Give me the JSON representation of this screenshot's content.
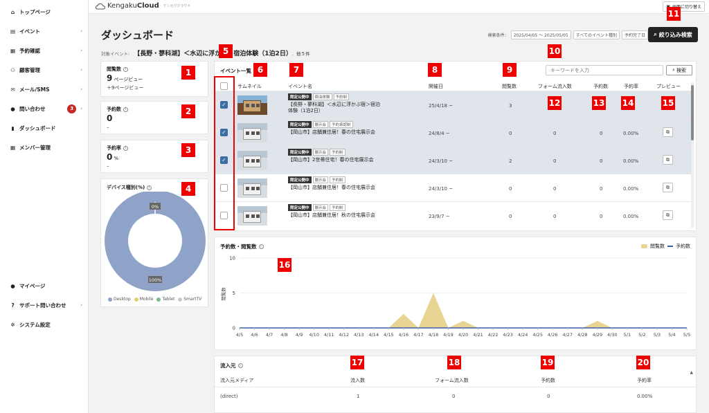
{
  "sidebar": {
    "items": [
      {
        "label": "トップページ",
        "icon": "home-icon",
        "chevron": false
      },
      {
        "label": "イベント",
        "icon": "document-icon",
        "chevron": true
      },
      {
        "label": "予約確認",
        "icon": "calendar-icon",
        "chevron": true
      },
      {
        "label": "顧客管理",
        "icon": "users-icon",
        "chevron": true
      },
      {
        "label": "メール/SMS",
        "icon": "mail-icon",
        "chevron": true
      },
      {
        "label": "問い合わせ",
        "icon": "chat-icon",
        "chevron": true,
        "badge": "3"
      },
      {
        "label": "ダッシュボード",
        "icon": "chart-icon",
        "chevron": false
      },
      {
        "label": "メンバー管理",
        "icon": "grid-icon",
        "chevron": false
      }
    ],
    "bottom_items": [
      {
        "label": "マイページ",
        "icon": "person-icon",
        "chevron": false
      },
      {
        "label": "サポート問い合わせ",
        "icon": "help-icon",
        "chevron": true
      },
      {
        "label": "システム設定",
        "icon": "gear-icon",
        "chevron": false
      }
    ]
  },
  "topbar": {
    "logo_light": "Kengaku",
    "logo_bold": "Cloud",
    "logo_sub": "ケンガククラウド",
    "switch_label": "画面に切り替え"
  },
  "page": {
    "title": "ダッシュボード",
    "target_label": "対象イベント:",
    "target_event": "【長野・蓼科湖】＜水辺に浮か",
    "target_event_rest": "宿泊体験（1泊2日）",
    "target_count": "他５件"
  },
  "filter": {
    "label": "検索条件：",
    "chips": [
      "2025/04/05 〜 2025/05/05",
      "すべてのイベント種別",
      "予約完了日"
    ],
    "search_button": "絞り込み検索"
  },
  "stats": {
    "views": {
      "label": "閲覧数",
      "value": "9",
      "unit": "ページビュー",
      "delta": "＋9ページビュー"
    },
    "reservations": {
      "label": "予約数",
      "value": "0",
      "delta": "–"
    },
    "rate": {
      "label": "予約率",
      "value": "0",
      "unit": "%",
      "delta": "–"
    }
  },
  "device": {
    "title": "デバイス種別(%)",
    "legend": [
      "Desktop",
      "Mobile",
      "Tablet",
      "SmartTV"
    ],
    "colors": [
      "#8fa3c9",
      "#e5cf6b",
      "#7fb68a",
      "#c9c9c9"
    ],
    "values": [
      100,
      0,
      0,
      0
    ],
    "label_top": "0%",
    "label_bottom": "100%"
  },
  "events": {
    "title": "イベント一覧",
    "keyword_placeholder": "キーワードを入力",
    "search_label": "検索",
    "headers": {
      "thumb": "サムネイル",
      "name": "イベント名",
      "date": "開催日",
      "views": "閲覧数",
      "form": "フォーム流入数",
      "reservations": "予約数",
      "rate": "予約率",
      "preview": "プレビュー"
    },
    "rows": [
      {
        "checked": true,
        "tags": [
          "限定公開中",
          "宿泊体験",
          "予約制"
        ],
        "name": "【長野・蓼科湖】＜水辺に浮かぶ宿＞宿泊体験（1泊2日）",
        "date": "25/4/18 ~",
        "views": "3",
        "form": "",
        "reservations": "",
        "rate": "",
        "thumb": "rust"
      },
      {
        "checked": true,
        "tags": [
          "限定公開中",
          "展示会",
          "予約承認制"
        ],
        "name": "【岡山市】店舗兼住居！春の住宅展示会",
        "date": "24/8/4 ~",
        "views": "0",
        "form": "0",
        "reservations": "0",
        "rate": "0.00%",
        "thumb": "white"
      },
      {
        "checked": true,
        "tags": [
          "限定公開中",
          "展示会",
          "予約制"
        ],
        "name": "【岡山市】2世帯住宅！春の住宅展示会",
        "date": "24/3/10 ~",
        "views": "2",
        "form": "0",
        "reservations": "0",
        "rate": "0.00%",
        "thumb": "white"
      },
      {
        "checked": false,
        "tags": [
          "限定公開中",
          "展示会",
          "予約制"
        ],
        "name": "【岡山市】店舗兼住居！春の住宅展示会",
        "date": "24/3/10 ~",
        "views": "0",
        "form": "0",
        "reservations": "0",
        "rate": "0.00%",
        "thumb": "white"
      },
      {
        "checked": false,
        "tags": [
          "限定公開中",
          "展示会",
          "予約制"
        ],
        "name": "【岡山市】店舗兼住居！秋の住宅展示会",
        "date": "23/9/7 ~",
        "views": "0",
        "form": "0",
        "reservations": "0",
        "rate": "0.00%",
        "thumb": "white"
      }
    ]
  },
  "chart_data": {
    "type": "area",
    "title": "予約数・閲覧数",
    "ylabel": "閲覧数",
    "ylim": [
      0,
      10
    ],
    "yticks": [
      0,
      5,
      10
    ],
    "x": [
      "4/5",
      "4/6",
      "4/7",
      "4/8",
      "4/9",
      "4/10",
      "4/11",
      "4/12",
      "4/13",
      "4/14",
      "4/15",
      "4/16",
      "4/17",
      "4/18",
      "4/19",
      "4/20",
      "4/21",
      "4/22",
      "4/23",
      "4/24",
      "4/25",
      "4/26",
      "4/27",
      "4/28",
      "4/29",
      "4/30",
      "5/1",
      "5/2",
      "5/3",
      "5/4",
      "5/5"
    ],
    "series": [
      {
        "name": "閲覧数",
        "type": "area",
        "color": "#e8d594",
        "values": [
          0,
          0,
          0,
          0,
          0,
          0,
          0,
          0,
          0,
          0,
          0,
          2,
          0,
          5,
          0,
          1,
          0,
          0,
          0,
          0,
          0,
          0,
          0,
          0,
          1,
          0,
          0,
          0,
          0,
          0,
          0
        ]
      },
      {
        "name": "予約数",
        "type": "line",
        "color": "#3a5fa8",
        "values": [
          0,
          0,
          0,
          0,
          0,
          0,
          0,
          0,
          0,
          0,
          0,
          0,
          0,
          0,
          0,
          0,
          0,
          0,
          0,
          0,
          0,
          0,
          0,
          0,
          0,
          0,
          0,
          0,
          0,
          0,
          0
        ]
      }
    ]
  },
  "sources": {
    "title": "流入元",
    "headers": [
      "流入元メディア",
      "流入数",
      "フォーム流入数",
      "予約数",
      "予約率"
    ],
    "rows": [
      [
        "(direct)",
        "1",
        "0",
        "0",
        "0.00%"
      ]
    ]
  },
  "markers": [
    "1",
    "2",
    "3",
    "4",
    "5",
    "6",
    "7",
    "8",
    "9",
    "10",
    "11",
    "12",
    "13",
    "14",
    "15",
    "16",
    "17",
    "18",
    "19",
    "20"
  ]
}
